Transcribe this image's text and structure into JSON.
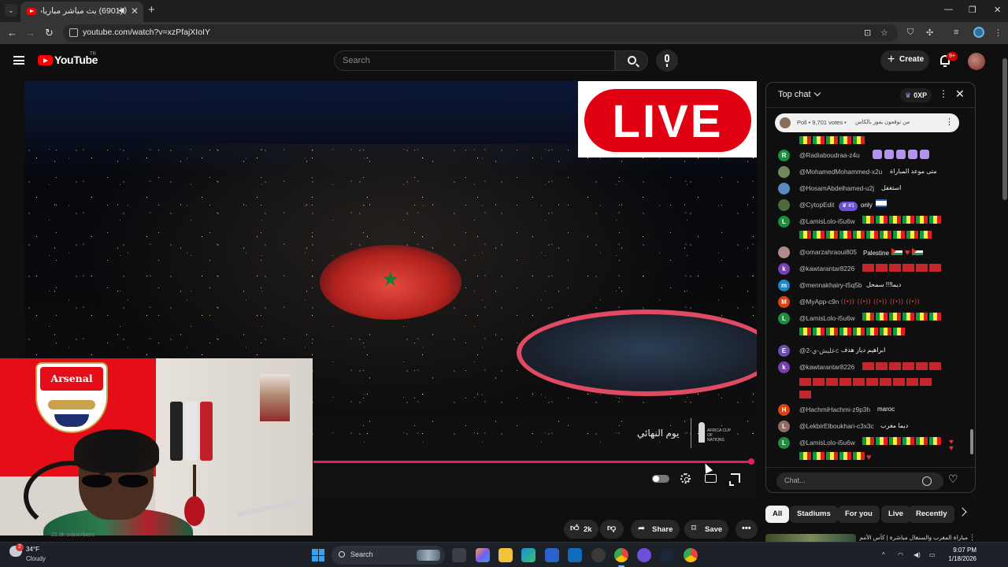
{
  "browser": {
    "tab_title": "(6901) بث مباشر مباريات الي...",
    "url": "youtube.com/watch?v=xzPfajXIoIY"
  },
  "masthead": {
    "logo_text": "YouTube",
    "region": "TR",
    "search_placeholder": "Search",
    "create_label": "Create",
    "notification_count": "9+"
  },
  "video": {
    "live_badge": "LIVE",
    "watermark_text": "يوم النهائي",
    "watermark_logo_text": "AFRICA CUP OF NATIONS",
    "progress": 0.99,
    "webcam_crest_text": "Arsenal",
    "subscribers": "21.3k subscribers"
  },
  "actions": {
    "likes": "2k",
    "share": "Share",
    "save": "Save"
  },
  "chips": [
    "All",
    "Stadiums",
    "For you",
    "Live",
    "Recently"
  ],
  "recommendation": {
    "title": "مباراة المغرب والسنغال مباشرة | كأس الأمم"
  },
  "chat": {
    "mode": "Top chat",
    "xp": "0XP",
    "poll_meta": "Poll • 9,701 votes •",
    "poll_question": "من توقعون يفوز بالكاس",
    "input_placeholder": "Chat...",
    "messages": [
      {
        "name": "@Radiaboudraa-z4u",
        "text": "",
        "initial": "R",
        "color": "#1e8e3e"
      },
      {
        "name": "@MohamedMohammed-x2u",
        "text": "متى موعد المباراة",
        "initial": "",
        "color": "#6f8a5a"
      },
      {
        "name": "@HosamAbdelhamed-u2j",
        "text": "استغفل",
        "initial": "",
        "color": "#5f87c6"
      },
      {
        "name": "@CytopEdit",
        "text": "only",
        "initial": "",
        "color": "#4c6b3d",
        "rank": "#1"
      },
      {
        "name": "@LamisLolo-i5u6w",
        "text": "",
        "initial": "L",
        "color": "#1e8e3e"
      },
      {
        "name": "@omarzahraoui805",
        "text": "Palestine",
        "initial": "",
        "color": "#b38a8a"
      },
      {
        "name": "@kawtarantar8226",
        "text": "",
        "initial": "k",
        "color": "#7b3fb4"
      },
      {
        "name": "@mennakhairy-t5q5b",
        "text": "ديما!!! سمحل",
        "initial": "m",
        "color": "#1e88c7"
      },
      {
        "name": "@MyApp-c9n",
        "text": "((•)) ((•)) ((•)) ((•)) ((•))",
        "initial": "M",
        "color": "#d84315"
      },
      {
        "name": "@LamisLolo-i5u6w",
        "text": "",
        "initial": "L",
        "color": "#1e8e3e"
      },
      {
        "name": "@عليش-ي-2c",
        "text": "ابراهيم دياز هدف",
        "initial": "E",
        "color": "#6a4fb0"
      },
      {
        "name": "@kawtarantar8226",
        "text": "",
        "initial": "k",
        "color": "#7b3fb4"
      },
      {
        "name": "@HachmiHachmi-z9p3h",
        "text": "maroc",
        "initial": "H",
        "color": "#d84315"
      },
      {
        "name": "@LekbirElboukhari-c3x3c",
        "text": "ديما مغرب",
        "initial": "L",
        "color": "#8d6e63"
      },
      {
        "name": "@LamisLolo-i5u6w",
        "text": "",
        "initial": "L",
        "color": "#1e8e3e"
      }
    ]
  },
  "taskbar": {
    "weather_badge": "2",
    "temperature": "34°F",
    "condition": "Cloudy",
    "search_label": "Search",
    "time": "9:07 PM",
    "date": "1/18/2026"
  }
}
